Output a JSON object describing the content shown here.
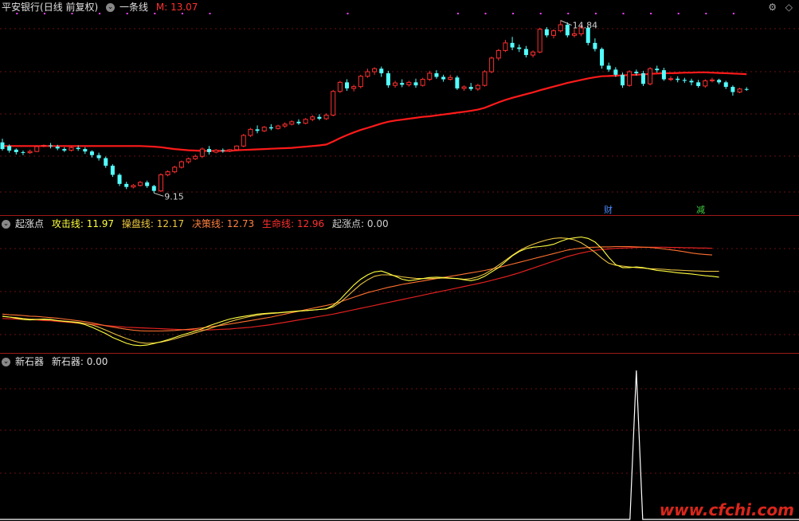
{
  "main_header": {
    "stock_name": "平安银行",
    "period": "(日线 前复权)",
    "indicator_name": "一条线",
    "m_label": "M: 13.07"
  },
  "panel2_header": {
    "name": "起涨点",
    "items": [
      {
        "label": "攻击线: 11.97",
        "color": "#ffff40"
      },
      {
        "label": "操盘线: 12.17",
        "color": "#f0c840"
      },
      {
        "label": "决策线: 12.73",
        "color": "#ff8040"
      },
      {
        "label": "生命线: 12.96",
        "color": "#ff3030"
      },
      {
        "label": "起涨点: 0.00",
        "color": "#d0d0d0"
      }
    ]
  },
  "panel3_header": {
    "name": "新石器",
    "item": "新石器: 0.00"
  },
  "right_controls": {
    "wheel": "⚙",
    "diamond": "◇"
  },
  "tags": [
    {
      "text": "财",
      "color": "#4a8cff"
    },
    {
      "text": "减",
      "color": "#40d040"
    }
  ],
  "watermark": "www.cfchi.com",
  "chart_data": {
    "type": "candlestick",
    "annotations": [
      {
        "text": "14.84",
        "type": "high"
      },
      {
        "text": "9.15",
        "type": "low"
      }
    ],
    "candles": [
      [
        10.82,
        10.94,
        10.6,
        10.55
      ],
      [
        10.7,
        10.75,
        10.55,
        10.48
      ],
      [
        10.58,
        10.62,
        10.5,
        10.42
      ],
      [
        10.5,
        10.55,
        10.48,
        10.4
      ],
      [
        10.48,
        10.58,
        10.52,
        10.44
      ],
      [
        10.52,
        10.72,
        10.68,
        10.5
      ],
      [
        10.7,
        10.75,
        10.72,
        10.66
      ],
      [
        10.72,
        10.8,
        10.7,
        10.62
      ],
      [
        10.68,
        10.74,
        10.62,
        10.56
      ],
      [
        10.6,
        10.66,
        10.55,
        10.5
      ],
      [
        10.56,
        10.7,
        10.65,
        10.52
      ],
      [
        10.64,
        10.72,
        10.6,
        10.54
      ],
      [
        10.6,
        10.66,
        10.52,
        10.44
      ],
      [
        10.52,
        10.56,
        10.4,
        10.32
      ],
      [
        10.4,
        10.48,
        10.3,
        10.22
      ],
      [
        10.3,
        10.35,
        10.05,
        9.98
      ],
      [
        10.05,
        10.1,
        9.75,
        9.68
      ],
      [
        9.75,
        9.8,
        9.45,
        9.38
      ],
      [
        9.45,
        9.52,
        9.35,
        9.28
      ],
      [
        9.35,
        9.45,
        9.4,
        9.3
      ],
      [
        9.4,
        9.55,
        9.5,
        9.36
      ],
      [
        9.5,
        9.56,
        9.38,
        9.32
      ],
      [
        9.38,
        9.42,
        9.22,
        9.15
      ],
      [
        9.22,
        9.8,
        9.75,
        9.18
      ],
      [
        9.75,
        9.9,
        9.85,
        9.7
      ],
      [
        9.85,
        10.05,
        10.0,
        9.8
      ],
      [
        10.0,
        10.22,
        10.18,
        9.96
      ],
      [
        10.18,
        10.32,
        10.28,
        10.12
      ],
      [
        10.28,
        10.42,
        10.36,
        10.24
      ],
      [
        10.36,
        10.65,
        10.6,
        10.3
      ],
      [
        10.6,
        10.7,
        10.5,
        10.42
      ],
      [
        10.5,
        10.6,
        10.56,
        10.46
      ],
      [
        10.56,
        10.62,
        10.54,
        10.48
      ],
      [
        10.54,
        10.6,
        10.58,
        10.5
      ],
      [
        10.58,
        10.72,
        10.7,
        10.54
      ],
      [
        10.7,
        11.1,
        11.05,
        10.66
      ],
      [
        11.05,
        11.3,
        11.25,
        11.0
      ],
      [
        11.25,
        11.38,
        11.2,
        11.12
      ],
      [
        11.2,
        11.36,
        11.32,
        11.16
      ],
      [
        11.32,
        11.42,
        11.28,
        11.22
      ],
      [
        11.28,
        11.4,
        11.36,
        11.24
      ],
      [
        11.36,
        11.48,
        11.42,
        11.3
      ],
      [
        11.42,
        11.55,
        11.5,
        11.38
      ],
      [
        11.5,
        11.58,
        11.45,
        11.4
      ],
      [
        11.45,
        11.62,
        11.58,
        11.42
      ],
      [
        11.58,
        11.72,
        11.66,
        11.52
      ],
      [
        11.66,
        11.75,
        11.6,
        11.55
      ],
      [
        11.6,
        11.78,
        11.72,
        11.56
      ],
      [
        11.72,
        12.55,
        12.5,
        11.68
      ],
      [
        12.5,
        12.85,
        12.8,
        12.45
      ],
      [
        12.8,
        12.9,
        12.6,
        12.52
      ],
      [
        12.6,
        12.72,
        12.66,
        12.5
      ],
      [
        12.66,
        13.05,
        13.0,
        12.6
      ],
      [
        13.0,
        13.25,
        13.15,
        12.95
      ],
      [
        13.15,
        13.3,
        13.25,
        13.05
      ],
      [
        13.25,
        13.32,
        13.1,
        12.98
      ],
      [
        13.1,
        13.18,
        12.7,
        12.62
      ],
      [
        12.7,
        12.85,
        12.78,
        12.62
      ],
      [
        12.78,
        12.9,
        12.72,
        12.64
      ],
      [
        12.72,
        12.85,
        12.8,
        12.66
      ],
      [
        12.8,
        12.92,
        12.7,
        12.62
      ],
      [
        12.7,
        12.95,
        12.9,
        12.66
      ],
      [
        12.9,
        13.18,
        13.1,
        12.85
      ],
      [
        13.1,
        13.2,
        12.98,
        12.92
      ],
      [
        12.98,
        13.05,
        12.9,
        12.82
      ],
      [
        12.9,
        13.05,
        12.96,
        12.86
      ],
      [
        12.96,
        13.02,
        12.6,
        12.55
      ],
      [
        12.6,
        12.7,
        12.65,
        12.52
      ],
      [
        12.65,
        12.78,
        12.58,
        12.52
      ],
      [
        12.58,
        12.75,
        12.7,
        12.52
      ],
      [
        12.7,
        13.2,
        13.15,
        12.66
      ],
      [
        13.15,
        13.65,
        13.6,
        13.1
      ],
      [
        13.6,
        13.9,
        13.85,
        13.52
      ],
      [
        13.85,
        14.2,
        14.1,
        13.8
      ],
      [
        14.1,
        14.3,
        13.95,
        13.86
      ],
      [
        13.95,
        14.05,
        13.9,
        13.8
      ],
      [
        13.9,
        14.0,
        13.7,
        13.62
      ],
      [
        13.7,
        13.85,
        13.8,
        13.62
      ],
      [
        13.8,
        14.6,
        14.55,
        13.76
      ],
      [
        14.55,
        14.62,
        14.35,
        14.28
      ],
      [
        14.35,
        14.55,
        14.5,
        14.25
      ],
      [
        14.5,
        14.84,
        14.7,
        14.45
      ],
      [
        14.7,
        14.78,
        14.35,
        14.28
      ],
      [
        14.35,
        14.55,
        14.4,
        14.28
      ],
      [
        14.4,
        14.7,
        14.6,
        14.32
      ],
      [
        14.6,
        14.65,
        14.1,
        14.02
      ],
      [
        14.1,
        14.25,
        13.9,
        13.82
      ],
      [
        13.9,
        13.95,
        13.35,
        13.25
      ],
      [
        13.35,
        13.45,
        13.22,
        13.15
      ],
      [
        13.22,
        13.3,
        13.05,
        12.98
      ],
      [
        13.05,
        13.12,
        12.7,
        12.62
      ],
      [
        12.7,
        13.2,
        13.15,
        12.66
      ],
      [
        13.15,
        13.22,
        13.1,
        13.02
      ],
      [
        13.1,
        13.18,
        12.75,
        12.68
      ],
      [
        12.75,
        13.3,
        13.25,
        12.7
      ],
      [
        13.25,
        13.35,
        13.2,
        13.12
      ],
      [
        13.2,
        13.28,
        12.9,
        12.85
      ],
      [
        12.9,
        13.0,
        12.92,
        12.84
      ],
      [
        12.92,
        13.0,
        12.88,
        12.8
      ],
      [
        12.88,
        12.95,
        12.85,
        12.78
      ],
      [
        12.85,
        12.92,
        12.8,
        12.7
      ],
      [
        12.8,
        12.88,
        12.68,
        12.62
      ],
      [
        12.68,
        12.9,
        12.85,
        12.62
      ],
      [
        12.85,
        12.95,
        12.88,
        12.8
      ],
      [
        12.88,
        12.92,
        12.8,
        12.74
      ],
      [
        12.8,
        12.85,
        12.65,
        12.58
      ],
      [
        12.65,
        12.7,
        12.48,
        12.36
      ],
      [
        12.48,
        12.62,
        12.58,
        12.44
      ],
      [
        12.58,
        12.64,
        12.57,
        12.52
      ]
    ],
    "ma_line": [
      10.7,
      10.7,
      10.7,
      10.7,
      10.7,
      10.7,
      10.7,
      10.7,
      10.7,
      10.7,
      10.7,
      10.7,
      10.7,
      10.7,
      10.7,
      10.7,
      10.7,
      10.7,
      10.7,
      10.7,
      10.7,
      10.69,
      10.68,
      10.66,
      10.63,
      10.6,
      10.58,
      10.56,
      10.55,
      10.54,
      10.54,
      10.54,
      10.54,
      10.54,
      10.56,
      10.57,
      10.58,
      10.59,
      10.6,
      10.61,
      10.62,
      10.63,
      10.64,
      10.66,
      10.68,
      10.7,
      10.72,
      10.75,
      10.85,
      10.96,
      11.06,
      11.15,
      11.23,
      11.3,
      11.37,
      11.44,
      11.5,
      11.54,
      11.57,
      11.6,
      11.63,
      11.66,
      11.68,
      11.71,
      11.74,
      11.77,
      11.8,
      11.83,
      11.86,
      11.9,
      11.96,
      12.05,
      12.14,
      12.22,
      12.29,
      12.35,
      12.41,
      12.47,
      12.54,
      12.6,
      12.66,
      12.72,
      12.78,
      12.83,
      12.88,
      12.93,
      12.97,
      13.0,
      13.01,
      13.02,
      13.03,
      13.04,
      13.05,
      13.06,
      13.08,
      13.09,
      13.1,
      13.1,
      13.11,
      13.12,
      13.12,
      13.13,
      13.13,
      13.12,
      13.11,
      13.1,
      13.09,
      13.08,
      13.07
    ],
    "oscillator": {
      "gongji_line": [
        10.63,
        10.6,
        10.56,
        10.52,
        10.5,
        10.52,
        10.53,
        10.52,
        10.48,
        10.45,
        10.43,
        10.4,
        10.34,
        10.25,
        10.14,
        10.03,
        9.9,
        9.8,
        9.7,
        9.64,
        9.62,
        9.64,
        9.69,
        9.75,
        9.82,
        9.9,
        9.98,
        10.05,
        10.12,
        10.2,
        10.3,
        10.38,
        10.46,
        10.53,
        10.58,
        10.62,
        10.66,
        10.7,
        10.72,
        10.74,
        10.75,
        10.77,
        10.79,
        10.81,
        10.82,
        10.84,
        10.86,
        10.88,
        11.0,
        11.2,
        11.45,
        11.7,
        11.9,
        12.05,
        12.15,
        12.18,
        12.1,
        12.0,
        11.9,
        11.85,
        11.88,
        11.92,
        11.96,
        11.97,
        11.96,
        11.94,
        11.92,
        11.88,
        11.85,
        11.9,
        12.0,
        12.15,
        12.3,
        12.5,
        12.7,
        12.85,
        12.95,
        13.0,
        13.02,
        13.05,
        13.1,
        13.2,
        13.28,
        13.32,
        13.35,
        13.3,
        13.18,
        12.95,
        12.65,
        12.4,
        12.3,
        12.3,
        12.32,
        12.3,
        12.25,
        12.2,
        12.18,
        12.15,
        12.12,
        12.1,
        12.08,
        12.05,
        12.02,
        12.0,
        11.97
      ],
      "caopan_line": [
        10.62,
        10.6,
        10.58,
        10.55,
        10.53,
        10.52,
        10.51,
        10.5,
        10.48,
        10.46,
        10.44,
        10.42,
        10.38,
        10.33,
        10.25,
        10.15,
        10.05,
        9.95,
        9.86,
        9.78,
        9.72,
        9.7,
        9.71,
        9.74,
        9.79,
        9.85,
        9.92,
        9.99,
        10.06,
        10.13,
        10.2,
        10.28,
        10.36,
        10.44,
        10.51,
        10.57,
        10.62,
        10.66,
        10.7,
        10.72,
        10.74,
        10.76,
        10.78,
        10.8,
        10.82,
        10.84,
        10.86,
        10.88,
        10.95,
        11.1,
        11.3,
        11.52,
        11.72,
        11.88,
        12.0,
        12.05,
        12.05,
        12.02,
        11.98,
        11.95,
        11.93,
        11.92,
        11.92,
        11.93,
        11.94,
        11.93,
        11.92,
        11.9,
        11.92,
        11.98,
        12.08,
        12.22,
        12.38,
        12.55,
        12.72,
        12.88,
        13.0,
        13.1,
        13.18,
        13.25,
        13.3,
        13.32,
        13.3,
        13.25,
        13.15,
        13.0,
        12.82,
        12.62,
        12.45,
        12.38,
        12.35,
        12.32,
        12.3,
        12.28,
        12.26,
        12.25,
        12.24,
        12.22,
        12.21,
        12.2,
        12.19,
        12.18,
        12.17,
        12.17,
        12.17
      ],
      "juece_line": [
        10.7,
        10.68,
        10.67,
        10.65,
        10.63,
        10.62,
        10.6,
        10.58,
        10.56,
        10.53,
        10.5,
        10.47,
        10.44,
        10.4,
        10.35,
        10.3,
        10.26,
        10.22,
        10.18,
        10.15,
        10.13,
        10.12,
        10.12,
        10.12,
        10.13,
        10.14,
        10.16,
        10.18,
        10.2,
        10.23,
        10.26,
        10.29,
        10.32,
        10.36,
        10.4,
        10.44,
        10.48,
        10.52,
        10.56,
        10.6,
        10.65,
        10.7,
        10.75,
        10.8,
        10.85,
        10.9,
        10.95,
        11.0,
        11.05,
        11.12,
        11.2,
        11.28,
        11.36,
        11.44,
        11.5,
        11.56,
        11.62,
        11.67,
        11.72,
        11.76,
        11.8,
        11.84,
        11.88,
        11.92,
        11.96,
        12.0,
        12.04,
        12.08,
        12.12,
        12.16,
        12.2,
        12.25,
        12.3,
        12.36,
        12.42,
        12.48,
        12.54,
        12.6,
        12.66,
        12.72,
        12.78,
        12.84,
        12.9,
        12.94,
        12.97,
        12.99,
        13.0,
        13.01,
        13.01,
        13.02,
        13.02,
        13.02,
        13.01,
        13.0,
        12.99,
        12.97,
        12.94,
        12.91,
        12.88,
        12.84,
        12.8,
        12.77,
        12.75,
        12.73
      ],
      "shengming_line": [
        10.55,
        10.54,
        10.53,
        10.52,
        10.51,
        10.5,
        10.48,
        10.47,
        10.45,
        10.43,
        10.41,
        10.39,
        10.37,
        10.35,
        10.33,
        10.31,
        10.29,
        10.27,
        10.25,
        10.24,
        10.23,
        10.22,
        10.21,
        10.2,
        10.19,
        10.18,
        10.17,
        10.16,
        10.16,
        10.16,
        10.16,
        10.17,
        10.18,
        10.19,
        10.21,
        10.23,
        10.25,
        10.28,
        10.31,
        10.34,
        10.38,
        10.42,
        10.46,
        10.5,
        10.54,
        10.58,
        10.62,
        10.66,
        10.7,
        10.75,
        10.8,
        10.85,
        10.9,
        10.95,
        11.0,
        11.05,
        11.1,
        11.15,
        11.2,
        11.25,
        11.3,
        11.35,
        11.4,
        11.45,
        11.5,
        11.55,
        11.6,
        11.65,
        11.7,
        11.75,
        11.8,
        11.86,
        11.92,
        11.98,
        12.05,
        12.12,
        12.2,
        12.28,
        12.36,
        12.44,
        12.52,
        12.6,
        12.68,
        12.74,
        12.8,
        12.85,
        12.89,
        12.92,
        12.94,
        12.96,
        12.97,
        12.98,
        12.99,
        13.0,
        13.0,
        13.0,
        13.0,
        12.99,
        12.99,
        12.98,
        12.98,
        12.97,
        12.97,
        12.96
      ],
      "qizhang_point": 0.0
    },
    "xinshiqi": {
      "spike_index": 92,
      "value": 0.0
    }
  }
}
